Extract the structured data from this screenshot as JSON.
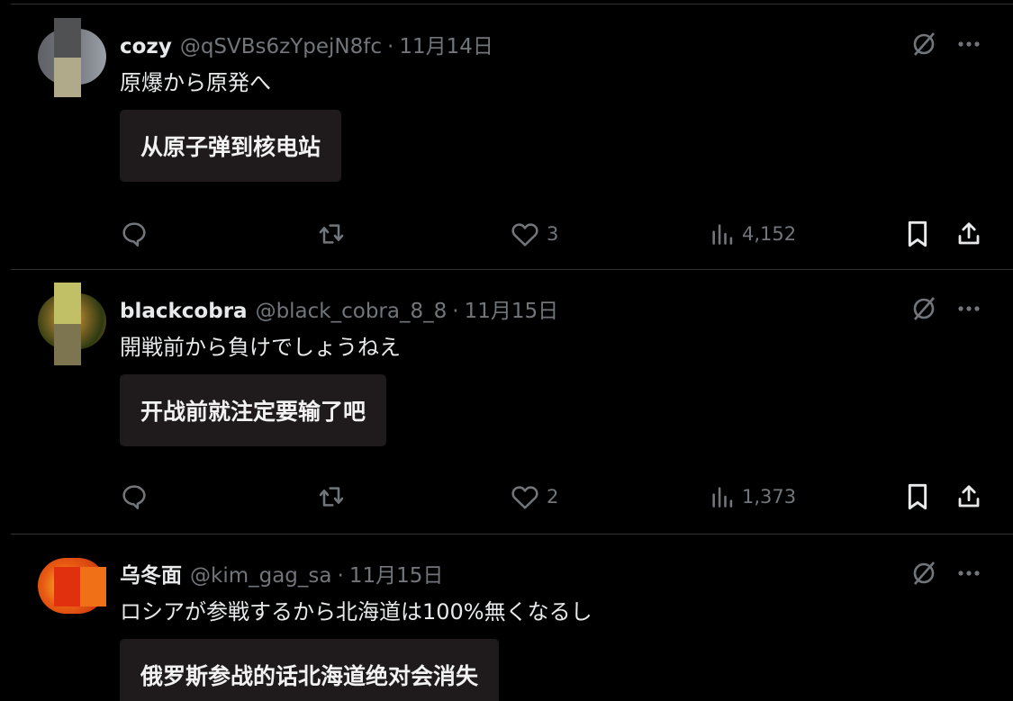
{
  "posts": [
    {
      "name": "cozy",
      "handle": "@qSVBs6zYpejN8fc",
      "separator": "·",
      "date": "11月14日",
      "text": "原爆から原発へ",
      "translation": "从原子弹到核电站",
      "likes": "3",
      "views": "4,152",
      "avatar_colors": [
        "#6a6d72",
        "#9aa0a8"
      ],
      "censor_colors": [
        "#4f5152",
        "#b1aa8a"
      ]
    },
    {
      "name": "blackcobra",
      "handle": "@black_cobra_8_8",
      "separator": "·",
      "date": "11月15日",
      "text": "開戦前から負けでしょうねえ",
      "translation": "开战前就注定要输了吧",
      "likes": "2",
      "views": "1,373",
      "avatar_colors": [
        "#3d4a18",
        "#b86a28"
      ],
      "censor_colors": [
        "#c2c066",
        "#7d7450"
      ]
    },
    {
      "name": "乌冬面",
      "handle": "@kim_gag_sa",
      "separator": "·",
      "date": "11月15日",
      "text": "ロシアが参戦するから北海道は100%無くなるし",
      "translation": "俄罗斯参战的话北海道绝对会消失",
      "avatar_colors": [
        "#d83a10",
        "#f0a020"
      ],
      "censor_colors": [
        "#e0300e",
        "#f07018"
      ]
    }
  ],
  "icons": {
    "grok": "slashed-circle-icon",
    "more": "more-dots-icon",
    "reply": "reply-icon",
    "repost": "repost-icon",
    "like": "heart-icon",
    "views": "views-bar-icon",
    "bookmark": "bookmark-icon",
    "share": "share-icon"
  },
  "colors": {
    "background": "#000000",
    "text": "#e7e9ea",
    "muted": "#71767b",
    "divider": "#2f3336",
    "translation_box": "#1f1a1c"
  }
}
